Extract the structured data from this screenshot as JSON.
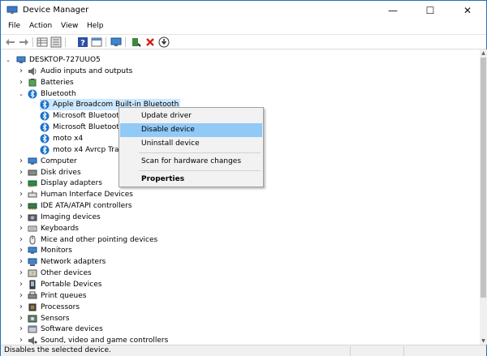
{
  "window": {
    "title": "Device Manager",
    "minimize": "—",
    "maximize": "☐",
    "close": "✕"
  },
  "menu": {
    "file": "File",
    "action": "Action",
    "view": "View",
    "help": "Help"
  },
  "toolbar_icons": [
    "back-arrow-icon",
    "forward-arrow-icon",
    "properties-grid-icon",
    "show-hidden-icon",
    "help-icon",
    "console-icon",
    "monitor-scan-icon",
    "update-driver-icon",
    "uninstall-x-icon",
    "disable-icon"
  ],
  "tree": {
    "root": "DESKTOP-727UUO5",
    "categories": [
      "Audio inputs and outputs",
      "Batteries",
      "Bluetooth",
      "Computer",
      "Disk drives",
      "Display adapters",
      "Human Interface Devices",
      "IDE ATA/ATAPI controllers",
      "Imaging devices",
      "Keyboards",
      "Mice and other pointing devices",
      "Monitors",
      "Network adapters",
      "Other devices",
      "Portable Devices",
      "Print queues",
      "Processors",
      "Sensors",
      "Software devices",
      "Sound, video and game controllers"
    ],
    "bluetooth_children": [
      "Apple Broadcom Built-in Bluetooth",
      "Microsoft Bluetooth",
      "Microsoft Bluetooth",
      "moto x4",
      "moto x4 Avrcp Tran"
    ]
  },
  "context_menu": {
    "update": "Update driver",
    "disable": "Disable device",
    "uninstall": "Uninstall device",
    "scan": "Scan for hardware changes",
    "properties": "Properties"
  },
  "status": "Disables the selected device.",
  "colors": {
    "selection": "#cce8ff",
    "menu_highlight": "#91c9f7",
    "bluetooth": "#1a73c9"
  }
}
